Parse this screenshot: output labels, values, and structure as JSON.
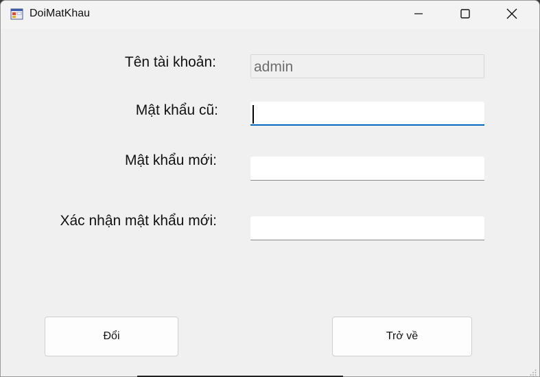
{
  "window": {
    "title": "DoiMatKhau"
  },
  "form": {
    "username_label": "Tên tài khoản:",
    "username_value": "admin",
    "old_password_label": "Mật khẩu cũ:",
    "old_password_value": "",
    "new_password_label": "Mật khẩu mới:",
    "new_password_value": "",
    "confirm_password_label": "Xác nhận mật khẩu mới:",
    "confirm_password_value": ""
  },
  "buttons": {
    "change_label": "Đổi",
    "back_label": "Trở về"
  },
  "colors": {
    "focus_accent": "#0067c0",
    "window_bg": "#f0f0f0"
  },
  "icons": {
    "app": "app-form-icon",
    "minimize": "minimize-icon",
    "maximize": "maximize-icon",
    "close": "close-icon",
    "resize": "resize-grip-icon"
  }
}
